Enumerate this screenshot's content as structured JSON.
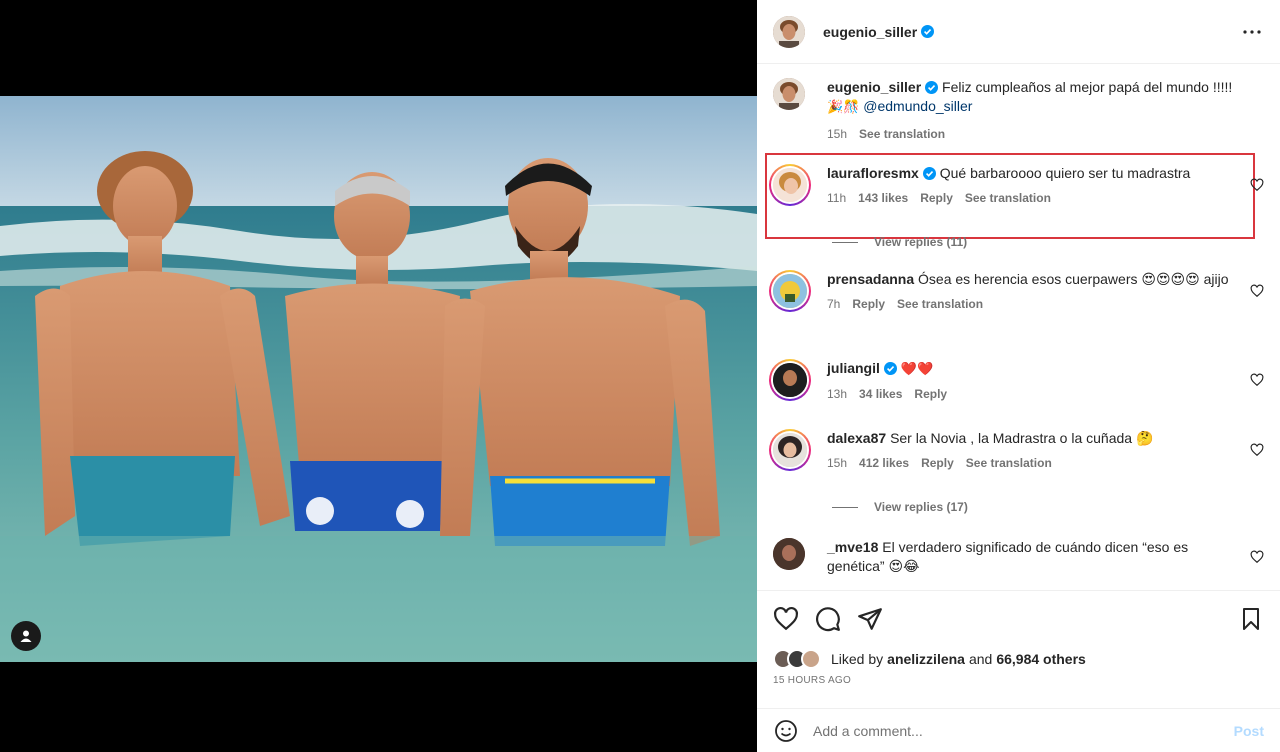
{
  "post": {
    "author": "eugenio_siller",
    "verified": true
  },
  "caption": {
    "username": "eugenio_siller",
    "text": "Feliz cumpleaños al mejor papá del mundo !!!!!",
    "emoji_line": "🎉🎊",
    "mention": "@edmundo_siller",
    "time": "15h",
    "see_translation": "See translation"
  },
  "comments": [
    {
      "username": "laurafloresmx",
      "verified": true,
      "text": "Qué barbaroooo quiero ser tu madrastra",
      "time": "11h",
      "likes": "143 likes",
      "reply": "Reply",
      "see_translation": "See translation",
      "view_replies": "View replies (11)"
    },
    {
      "username": "prensadanna",
      "verified": false,
      "text": "Ósea es herencia esos cuerpawers 😍😍😍😍 ajijo",
      "time": "7h",
      "reply": "Reply",
      "see_translation": "See translation"
    },
    {
      "username": "juliangil",
      "verified": true,
      "text": "❤️❤️",
      "time": "13h",
      "likes": "34 likes",
      "reply": "Reply"
    },
    {
      "username": "dalexa87",
      "verified": false,
      "text": "Ser la Novia , la Madrastra o la cuñada 🤔",
      "time": "15h",
      "likes": "412 likes",
      "reply": "Reply",
      "see_translation": "See translation",
      "view_replies": "View replies (17)"
    },
    {
      "username": "_mve18",
      "verified": false,
      "text": "El verdadero significado de cuándo dicen “eso es genética” 😍😂"
    }
  ],
  "likes": {
    "prefix": "Liked by",
    "user": "anelizzilena",
    "and": "and",
    "others": "66,984 others"
  },
  "timestamp": "15 HOURS AGO",
  "add_comment": {
    "placeholder": "Add a comment...",
    "post_label": "Post"
  },
  "colors": {
    "highlight": "#d9363e",
    "verified": "#0095f6",
    "heart_red": "#ed1c24",
    "mention": "#00376b"
  }
}
